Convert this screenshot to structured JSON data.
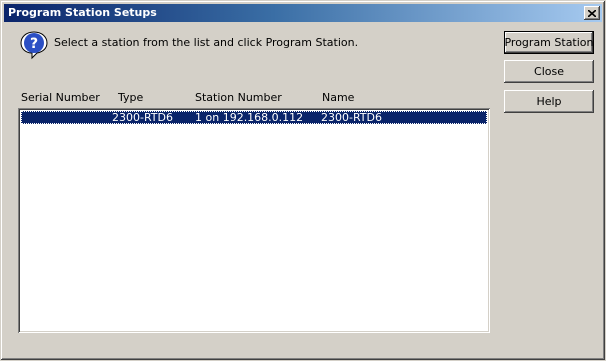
{
  "window": {
    "title": "Program Station Setups",
    "close_glyph": "✕"
  },
  "prompt": {
    "icon": "question-icon",
    "text": "Select a station from the list and click Program Station."
  },
  "buttons": {
    "program_station": "Program Station",
    "close": "Close",
    "help": "Help"
  },
  "list": {
    "columns": [
      "Serial Number",
      "Type",
      "Station Number",
      "Name"
    ],
    "rows": [
      {
        "serial_number": "",
        "type": "2300-RTD6",
        "station_number": "1 on 192.168.0.112",
        "name": "2300-RTD6",
        "selected": true
      }
    ]
  },
  "colors": {
    "titlebar_start": "#0a246a",
    "titlebar_end": "#a6caf0",
    "selection": "#0a246a",
    "face": "#d4d0c8"
  }
}
